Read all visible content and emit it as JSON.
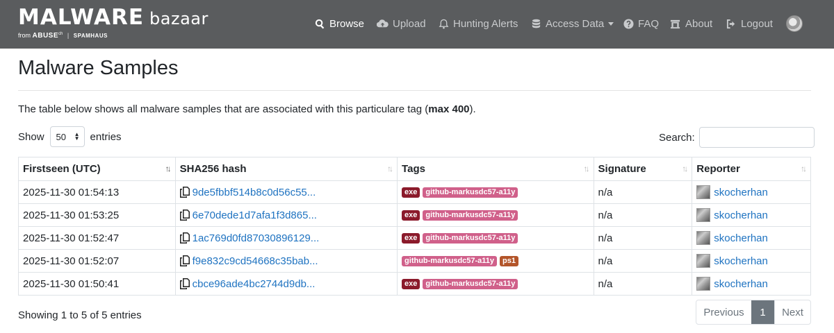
{
  "brand": {
    "main": "MALWARE",
    "sub": "bazaar",
    "from": "from",
    "abuse": "ABUSE",
    "abuse_sup": "ch",
    "spamhaus": "SPAMHAUS"
  },
  "nav": {
    "browse": "Browse",
    "upload": "Upload",
    "hunting": "Hunting Alerts",
    "access": "Access Data",
    "faq": "FAQ",
    "about": "About",
    "logout": "Logout"
  },
  "page": {
    "title": "Malware Samples",
    "desc_pre": "The table below shows all malware samples that are associated with this particulare tag (",
    "desc_bold": "max 400",
    "desc_post": ").",
    "show_label": "Show",
    "show_value": "50",
    "entries_label": "entries",
    "search_label": "Search:",
    "search_value": ""
  },
  "table": {
    "headers": [
      "Firstseen (UTC)",
      "SHA256 hash",
      "Tags",
      "Signature",
      "Reporter"
    ],
    "rows": [
      {
        "date": "2025-11-30 01:54:13",
        "hash": "9de5fbbf514b8c0d56c55...",
        "tags": [
          "exe",
          "github-markusdc57-a11y"
        ],
        "signature": "n/a",
        "reporter": "skocherhan"
      },
      {
        "date": "2025-11-30 01:53:25",
        "hash": "6e70dede1d7afa1f3d865...",
        "tags": [
          "exe",
          "github-markusdc57-a11y"
        ],
        "signature": "n/a",
        "reporter": "skocherhan"
      },
      {
        "date": "2025-11-30 01:52:47",
        "hash": "1ac769d0fd87030896129...",
        "tags": [
          "exe",
          "github-markusdc57-a11y"
        ],
        "signature": "n/a",
        "reporter": "skocherhan"
      },
      {
        "date": "2025-11-30 01:52:07",
        "hash": "f9e832c9cd54668c35bab...",
        "tags": [
          "github-markusdc57-a11y",
          "ps1"
        ],
        "signature": "n/a",
        "reporter": "skocherhan"
      },
      {
        "date": "2025-11-30 01:50:41",
        "hash": "cbce96ade4bc2744d9db...",
        "tags": [
          "exe",
          "github-markusdc57-a11y"
        ],
        "signature": "n/a",
        "reporter": "skocherhan"
      }
    ]
  },
  "footer": {
    "info": "Showing 1 to 5 of 5 entries",
    "prev": "Previous",
    "page": "1",
    "next": "Next"
  },
  "colors": {
    "navbar": "#5a5c5e",
    "link": "#1f73c1",
    "tag_exe": "#8b1a2b",
    "tag_github": "#d0608a",
    "tag_ps1": "#b3552a"
  }
}
